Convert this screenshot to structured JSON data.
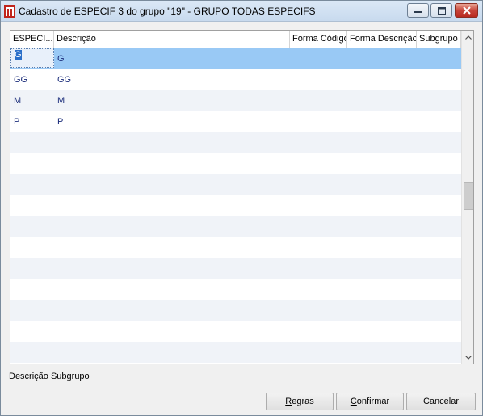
{
  "window": {
    "title": "Cadastro de ESPECIF 3 do grupo \"19\" - GRUPO TODAS ESPECIFS",
    "app_icon": "application-icon",
    "controls": [
      "minimize-icon",
      "maximize-icon",
      "close-icon"
    ]
  },
  "grid": {
    "columns": [
      "ESPECI...",
      "Descrição",
      "Forma Código",
      "Forma Descrição",
      "Subgrupo"
    ],
    "rows": [
      {
        "code": "G",
        "description": "G",
        "selected": true
      },
      {
        "code": "GG",
        "description": "GG"
      },
      {
        "code": "M",
        "description": "M"
      },
      {
        "code": "P",
        "description": "P"
      }
    ],
    "empty_row_count": 11,
    "colors": {
      "selected_row": "#99c9f5",
      "alt_row": "#f0f3f8",
      "cell_text": "#1a2c7a"
    }
  },
  "footer": {
    "status_label": "Descrição Subgrupo",
    "buttons": {
      "regras": {
        "first": "R",
        "rest": "egras"
      },
      "confirmar": {
        "first": "C",
        "rest": "onfirmar"
      },
      "cancelar": "Cancelar"
    }
  }
}
